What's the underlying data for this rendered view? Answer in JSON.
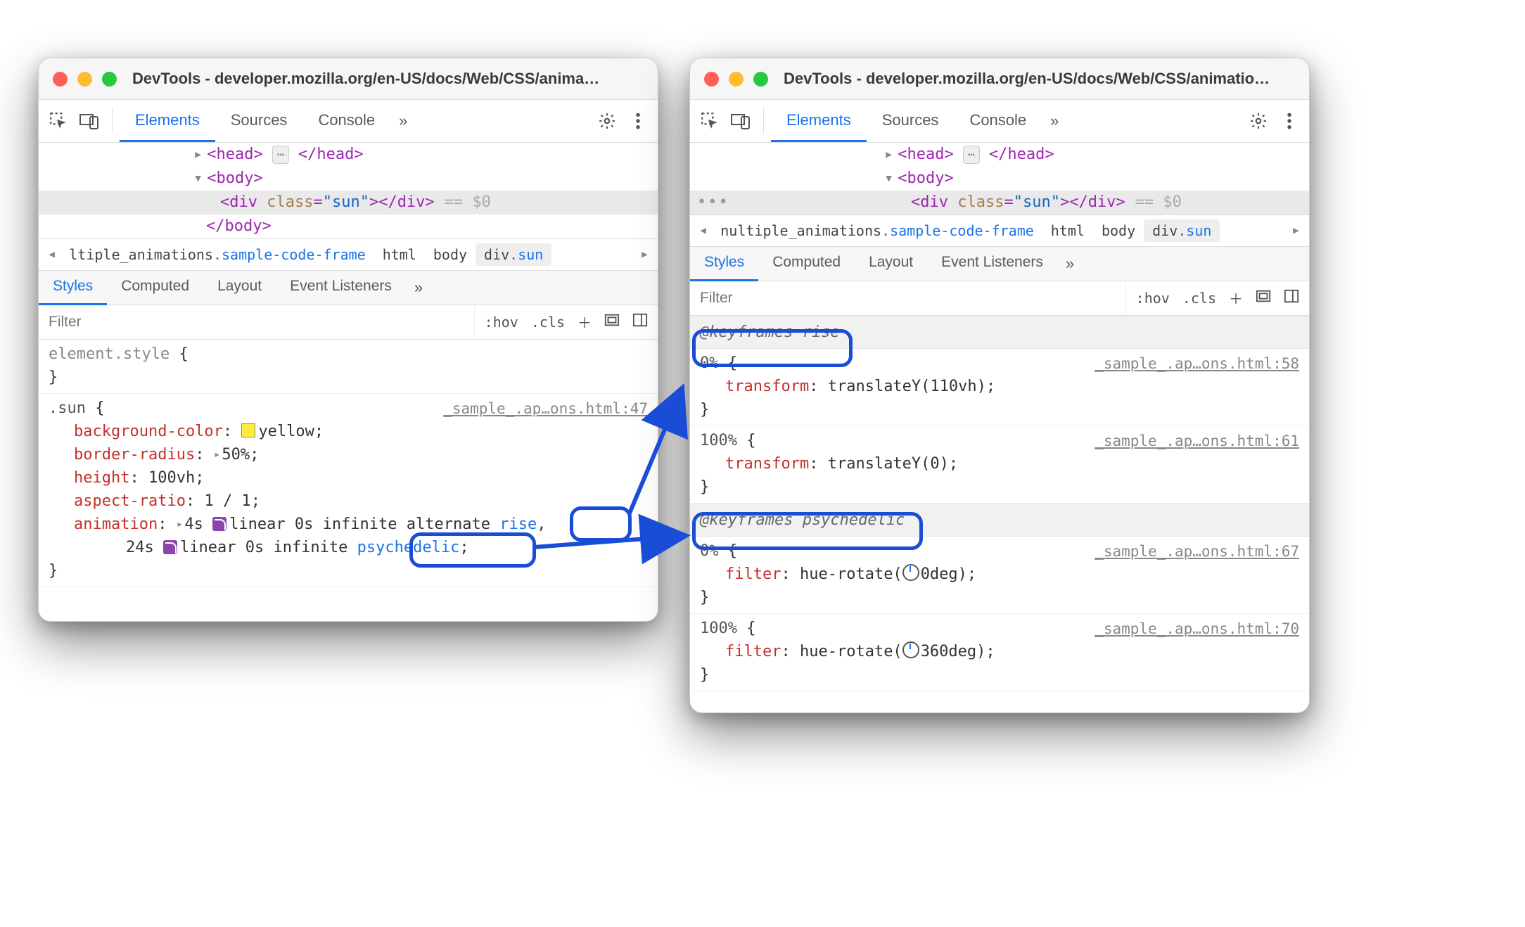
{
  "windows": [
    {
      "title": "DevTools - developer.mozilla.org/en-US/docs/Web/CSS/anima…",
      "tabs": {
        "elements": "Elements",
        "sources": "Sources",
        "console": "Console"
      },
      "dom": {
        "head_open": "<head>",
        "head_close": "</head>",
        "body_open": "<body>",
        "body_close": "</body>",
        "div_tag_open": "<div ",
        "div_cls_attr": "class",
        "div_cls_val": "\"sun\"",
        "div_tag_mid": ">",
        "div_close": "</div>",
        "eq": "== $0"
      },
      "breadcrumb": {
        "path": "ltiple_animations",
        "cls": ".sample-code-frame",
        "html": "html",
        "body": "body",
        "leaf": "div",
        "leafcls": ".sun"
      },
      "subtabs": {
        "styles": "Styles",
        "computed": "Computed",
        "layout": "Layout",
        "listeners": "Event Listeners"
      },
      "filter": {
        "placeholder": "Filter",
        "hov": ":hov",
        "cls": ".cls"
      },
      "rules": {
        "elstyle_sel": "element.style",
        "sun_sel": ".sun",
        "sun_src": "_sample_.ap…ons.html:47",
        "bg_prop": "background-color",
        "bg_val": "yellow",
        "br_prop": "border-radius",
        "br_val": "50%",
        "h_prop": "height",
        "h_val": "100vh",
        "ar_prop": "aspect-ratio",
        "ar_val": "1 / 1",
        "anim_prop": "animation",
        "anim1_pre": "4s ",
        "anim1_easing": "linear",
        "anim1_mid": " 0s infinite alternate ",
        "anim1_name": "rise",
        "anim2_pre": "24s ",
        "anim2_easing": "linear",
        "anim2_mid": " 0s infinite ",
        "anim2_name": "psychedelic"
      }
    },
    {
      "title": "DevTools - developer.mozilla.org/en-US/docs/Web/CSS/animatio…",
      "tabs": {
        "elements": "Elements",
        "sources": "Sources",
        "console": "Console"
      },
      "dom": {
        "head_open": "<head>",
        "head_close": "</head>",
        "body_open": "<body>",
        "body_close": "</body>",
        "div_tag_open": "<div ",
        "div_cls_attr": "class",
        "div_cls_val": "\"sun\"",
        "div_tag_mid": ">",
        "div_close": "</div>",
        "eq": "== $0"
      },
      "breadcrumb": {
        "path": "nultiple_animations",
        "cls": ".sample-code-frame",
        "html": "html",
        "body": "body",
        "leaf": "div",
        "leafcls": ".sun"
      },
      "subtabs": {
        "styles": "Styles",
        "computed": "Computed",
        "layout": "Layout",
        "listeners": "Event Listeners"
      },
      "filter": {
        "placeholder": "Filter",
        "hov": ":hov",
        "cls": ".cls"
      },
      "keyframes": {
        "rise_header": "@keyframes rise",
        "rise_0_src": "_sample_.ap…ons.html:58",
        "rise_0_sel": "0%",
        "rise_0_prop": "transform",
        "rise_0_val": "translateY(110vh)",
        "rise_100_src": "_sample_.ap…ons.html:61",
        "rise_100_sel": "100%",
        "rise_100_prop": "transform",
        "rise_100_val": "translateY(0)",
        "psy_header": "@keyframes psychedelic",
        "psy_0_src": "_sample_.ap…ons.html:67",
        "psy_0_sel": "0%",
        "psy_0_prop": "filter",
        "psy_0_val_fn": "hue-rotate(",
        "psy_0_val_deg": "0deg",
        "psy_100_src": "_sample_.ap…ons.html:70",
        "psy_100_sel": "100%",
        "psy_100_prop": "filter",
        "psy_100_val_fn": "hue-rotate(",
        "psy_100_val_deg": "360deg"
      }
    }
  ]
}
